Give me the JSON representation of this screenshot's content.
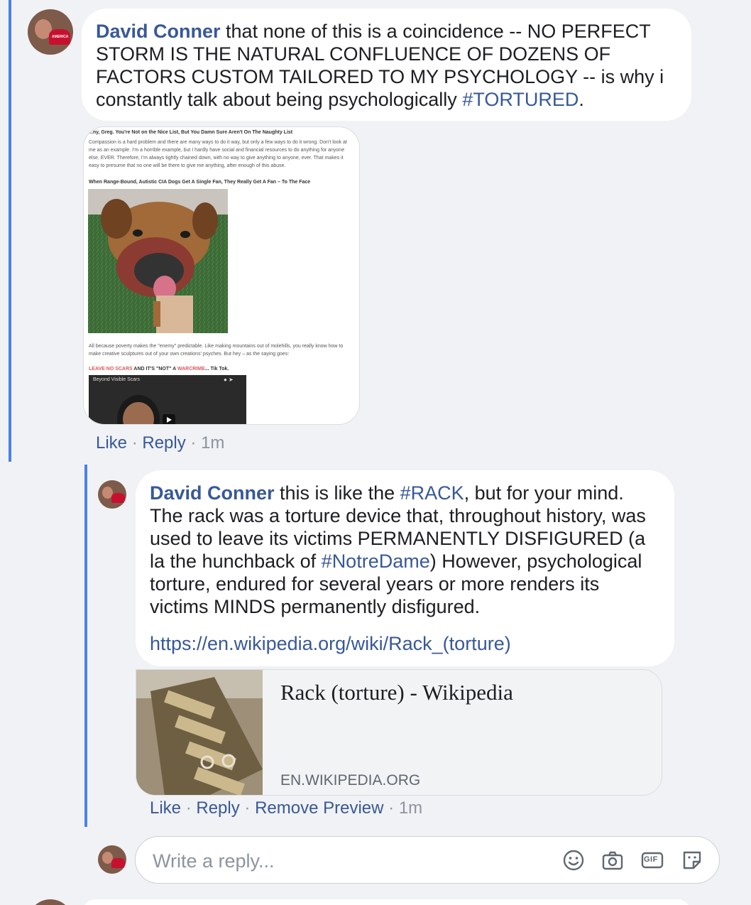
{
  "comment": {
    "author": "David Conner",
    "text_before": " that none of this is a coincidence -- NO PERFECT STORM IS THE NATURAL CONFLUENCE OF DOZENS OF FACTORS CUSTOM TAILORED TO MY PSYCHOLOGY -- is why i constantly talk about being psychologically ",
    "hashtag": "#TORTURED",
    "text_after": ".",
    "attachment": {
      "line1": "...ny, Greg. You're Not on the Nice List, But You Damn Sure Aren't On The Naughty List",
      "para1": "Compassion is a hard problem and there are many ways to do it way, but only a few ways to do it wrong. Don't look at me as an example. I'm a horrible example, but I hardly have social and financial resources to do anything for anyone else, EVER. Therefore, I'm always tightly chained down, with no way to give anything to anyone, ever. That makes it easy to presume that no one will be there to give me anything, after enough of this abuse.",
      "heading2": "When Range-Bound, Autistic CIA Dogs Get A Single Fan, They Really Get A Fan – To The Face",
      "para2": "All because poverty makes the \"enemy\" predictable. Like making mountains out of molehills, you really know how to make creative sculptures out of your own creations' psyches. But hey – as the saying goes:",
      "line_red1": "LEAVE NO SCARS",
      "line_mid": " AND IT'S \"NOT\" A ",
      "line_red2": "WARCRIME",
      "line_end": "... Tik Tok.",
      "video_title": "Beyond Visible Scars"
    },
    "actions": {
      "like": "Like",
      "reply": "Reply",
      "time": "1m",
      "sep": "·"
    }
  },
  "reply": {
    "author": "David Conner",
    "t1": " this is like the ",
    "h1": "#RACK",
    "t2": ", but for your mind. The rack was a torture device that, throughout history, was used to leave its victims PERMANENTLY DISFIGURED (a la the hunchback of ",
    "h2": "#NotreDame",
    "t3": ") However, psychological torture, endured for several years or more renders its victims MINDS permanently disfigured.",
    "url": "https://en.wikipedia.org/wiki/Rack_(torture)",
    "preview": {
      "title": "Rack (torture) - Wikipedia",
      "domain": "EN.WIKIPEDIA.ORG"
    },
    "actions": {
      "like": "Like",
      "reply": "Reply",
      "remove_preview": "Remove Preview",
      "time": "1m",
      "sep": "·"
    }
  },
  "reply_box": {
    "placeholder": "Write a reply...",
    "icons": [
      "smiley-icon",
      "camera-icon",
      "gif-icon",
      "sticker-icon"
    ],
    "gif_label": "GIF"
  },
  "colors": {
    "link": "#385898",
    "thread_bar": "#4a82e6",
    "background": "#f1f2f5"
  }
}
